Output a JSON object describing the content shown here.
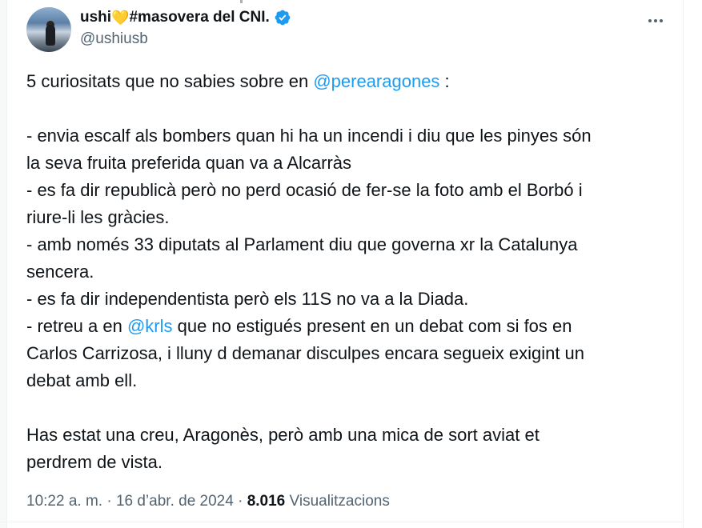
{
  "tweet": {
    "author": {
      "name": "ushi",
      "name_suffix": "#masovera del CNI.",
      "heart_emoji": "💛",
      "handle": "@ushiusb",
      "verified": true
    },
    "intro_before": "5 curiositats que no sabies sobre en ",
    "intro_mention": "@perearagones",
    "intro_after": " :",
    "line1a": "- envia escalf als bombers quan hi ha un incendi i diu que  les pinyes són",
    "line1b": "la  seva fruita preferida quan va a Alcarràs",
    "line2a": "- es fa dir republicà però no perd ocasió de fer-se la foto amb el Borbó i",
    "line2b": "riure-li les gràcies.",
    "line3a": "- amb només 33 diputats al Parlament diu que governa xr la Catalunya",
    "line3b": "sencera.",
    "line4": "- es fa dir independentista però els 11S no va a la Diada.",
    "line5_before": "- retreu a en ",
    "line5_mention": "@krls",
    "line5_after": " que no estigués present en un debat com si fos en",
    "line5b": "Carlos Carrizosa, i lluny d demanar disculpes encara segueix exigint un",
    "line5c": "debat amb ell.",
    "closing_a": "Has estat una creu, Aragonès, però amb una mica de sort aviat et",
    "closing_b": "perdrem de vista.",
    "time": "10:22 a. m.",
    "separator": "·",
    "date": "16 d’abr. de 2024",
    "views_count": "8.016",
    "views_label": "Visualitzacions"
  },
  "colors": {
    "accent": "#1d9bf0",
    "text": "#0f1419",
    "secondary": "#536471",
    "heart": "#ffcc4d"
  },
  "icons": {
    "verified": "verified-badge-icon",
    "more": "more-options-icon"
  }
}
